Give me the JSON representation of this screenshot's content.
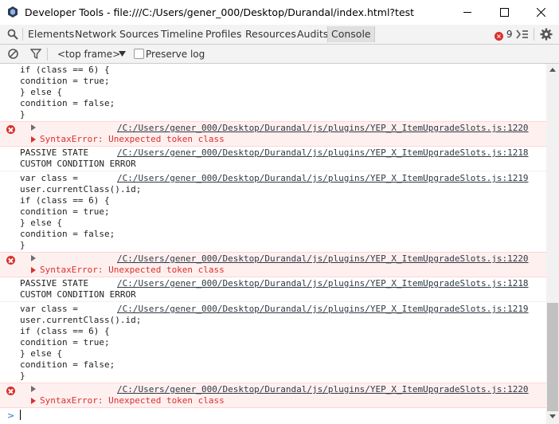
{
  "window": {
    "title": "Developer Tools - file:///C:/Users/gener_000/Desktop/Durandal/index.html?test"
  },
  "tabs": [
    {
      "label": "Elements"
    },
    {
      "label": "Network"
    },
    {
      "label": "Sources"
    },
    {
      "label": "Timeline"
    },
    {
      "label": "Profiles"
    },
    {
      "label": "Resources"
    },
    {
      "label": "Audits"
    },
    {
      "label": "Console"
    }
  ],
  "error_count": "9",
  "filterbar": {
    "context": "<top frame>",
    "preserve_log": "Preserve log"
  },
  "console": {
    "lines": [
      "if (class == 6) {",
      "condition = true;",
      "} else {",
      "condition = false;",
      "}",
      "PASSIVE STATE",
      "CUSTOM CONDITION ERROR",
      "var class =",
      "user.currentClass().id;",
      "if (class == 6) {",
      "condition = true;",
      "} else {",
      "condition = false;",
      "}",
      "PASSIVE STATE",
      "CUSTOM CONDITION ERROR",
      "var class =",
      "user.currentClass().id;",
      "if (class == 6) {",
      "condition = true;",
      "} else {",
      "condition = false;",
      "}"
    ],
    "error_text": "SyntaxError: Unexpected token class",
    "link_1220": "/C:/Users/gener_000/Desktop/Durandal/js/plugins/YEP_X_ItemUpgradeSlots.js:1220",
    "link_1218": "/C:/Users/gener_000/Desktop/Durandal/js/plugins/YEP_X_ItemUpgradeSlots.js:1218",
    "link_1219": "/C:/Users/gener_000/Desktop/Durandal/js/plugins/YEP_X_ItemUpgradeSlots.js:1219"
  }
}
